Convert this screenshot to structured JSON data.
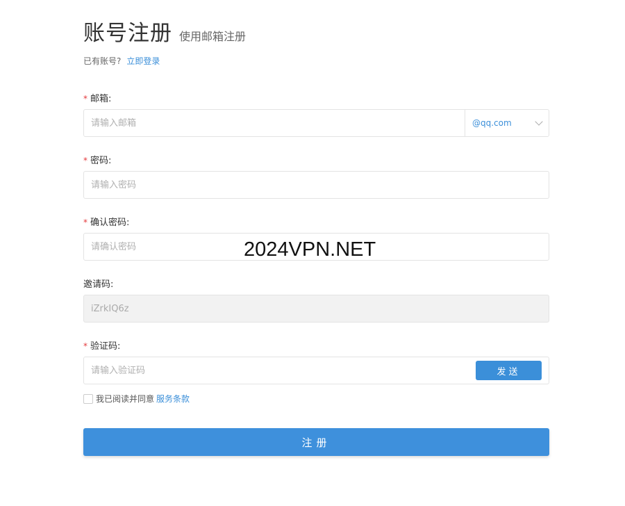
{
  "header": {
    "title": "账号注册",
    "subtitle": "使用邮箱注册",
    "have_account": "已有账号?",
    "login_link": "立即登录"
  },
  "form": {
    "email": {
      "label": "邮箱:",
      "placeholder": "请输入邮箱",
      "domain": "@qq.com",
      "required": true
    },
    "password": {
      "label": "密码:",
      "placeholder": "请输入密码",
      "required": true
    },
    "confirm": {
      "label": "确认密码:",
      "placeholder": "请确认密码",
      "required": true
    },
    "invite": {
      "label": "邀请码:",
      "value": "iZrkIQ6z",
      "disabled": true
    },
    "captcha": {
      "label": "验证码:",
      "placeholder": "请输入验证码",
      "send_label": "发送",
      "required": true
    },
    "agree_text": "我已阅读并同意",
    "terms_link": "服务条款",
    "submit_label": "注册",
    "required_mark": "*"
  },
  "watermark": "2024VPN.NET",
  "colors": {
    "accent": "#3b8fd9",
    "required": "#e4393c",
    "disabled_bg": "#f2f2f2"
  }
}
